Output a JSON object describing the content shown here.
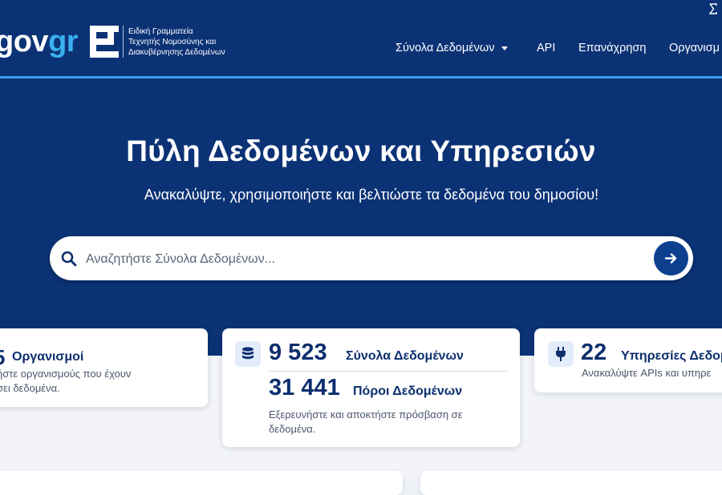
{
  "header": {
    "logo": {
      "gov": "gov",
      "gr": "gr"
    },
    "org_lines": [
      "Ειδική Γραμματεία",
      "Τεχνητής Νομοσύνης και",
      "Διακυβέρνησης Δεδομένων"
    ],
    "nav": [
      {
        "label": "Σύνολα Δεδομένων",
        "dropdown": true
      },
      {
        "label": "API"
      },
      {
        "label": "Επανάχρηση"
      },
      {
        "label": "Οργανισμ"
      }
    ]
  },
  "hero": {
    "title": "Πύλη Δεδομένων και Υπηρεσιών",
    "subtitle": "Ανακαλύψτε, χρησιμοποιήστε και βελτιώστε τα δεδομένα του δημοσίου!"
  },
  "search": {
    "placeholder": "Αναζητήστε Σύνολα Δεδομένων..."
  },
  "stats": {
    "organizations": {
      "count": "5",
      "label": "Οργανισμοί",
      "desc_lines": [
        "ήστε οργανισμούς που έχουν",
        "σει δεδομένα."
      ]
    },
    "datasets": {
      "count": "9 523",
      "label": "Σύνολα Δεδομένων",
      "resources_count": "31 441",
      "resources_label": "Πόροι Δεδομένων",
      "desc_lines": [
        "Εξερευνήστε και αποκτήστε πρόσβαση σε",
        "δεδομένα."
      ]
    },
    "services": {
      "count": "22",
      "label": "Υπηρεσίες Δεδομ",
      "desc": "Ανακαλύψτε APIs και υπηρε"
    }
  },
  "colors": {
    "hero_bg": "#0b3275",
    "accent": "#3ab0f0",
    "stat_text": "#0d2f6e",
    "button": "#0d3f8f"
  }
}
